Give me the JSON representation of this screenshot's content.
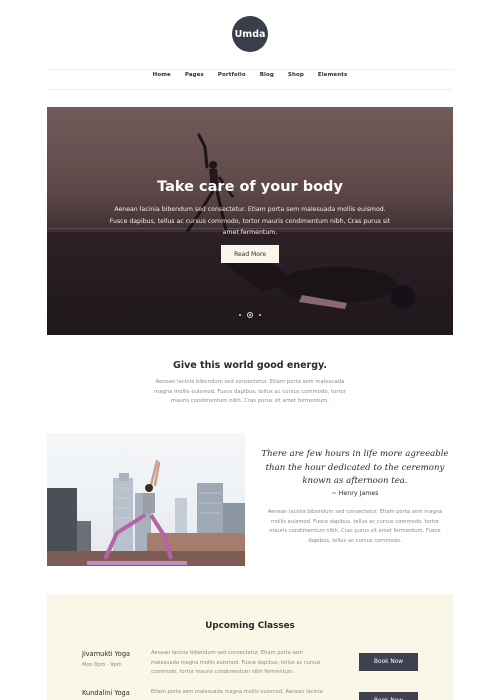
{
  "brand": {
    "logo_text": "Umda"
  },
  "nav": {
    "items": [
      "Home",
      "Pages",
      "Portfolio",
      "Blog",
      "Shop",
      "Elements"
    ]
  },
  "hero": {
    "title": "Take care of your body",
    "text": "Aenean lacinia bibendum sed consectetur. Etiam porta sem malesuada mollis euismod. Fusce dapibus, tellus ac cursus commodo, tortor mauris condimentum nibh, Cras purus sit amet fermentum.",
    "button_label": "Read More"
  },
  "energy": {
    "title": "Give this world good energy.",
    "text": "Aenean lacinia bibendum sed consectetur. Etiam porta sem malesuada magna mollis euismod. Fusce dapibus, tellus ac cursus commodo, tortor mauris condimentum nibh. Cras purus sit amet fermentum."
  },
  "quote": {
    "text": "There are few hours in life more agreeable than the hour dedicated to the ceremony known as afternoon tea.",
    "author": "~ Henry James",
    "body": "Aenean lacinia bibendum sed consectetur. Etiam porta sem magna mollis euismod. Fusce dapibus, tellus ac cursus commodo, tortor mauris condimentum nibh. Cras purus sit amet fermentum. Fusce dapibus, tellus ac cursus commodo."
  },
  "classes": {
    "title": "Upcoming Classes",
    "items": [
      {
        "name": "Jivamukti Yoga",
        "time": "Mon 8pm - 9pm",
        "desc": "Aenean lacinia bibendum sed consectetur. Etiam porta sem malesuada magna mollis euismod. Fusce dapibus, tellus ac cursus commodo, tortor mauris condimentum nibh fermentum.",
        "button_label": "Book Now"
      },
      {
        "name": "Kundalini Yoga",
        "time": "",
        "desc": "Etiam porta sem malesuada magna mollis euismod. Aenean lacinia",
        "button_label": "Book Now"
      }
    ]
  },
  "colors": {
    "dark": "#3a3d4a",
    "cream": "#fbf7e8",
    "hero_button": "#fbf6ea"
  },
  "icons": [
    "slider-dot",
    "slider-dot-active"
  ]
}
